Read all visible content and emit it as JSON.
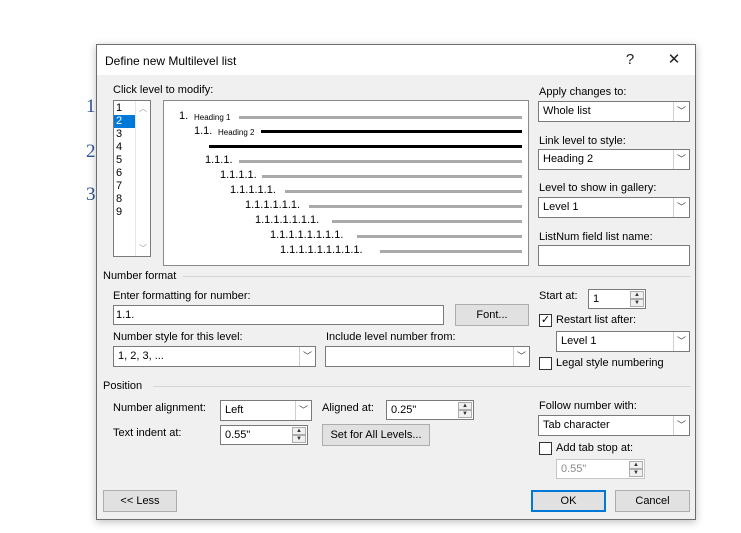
{
  "background_numbers": [
    "1",
    "2",
    "3"
  ],
  "dialog": {
    "title": "Define new Multilevel list",
    "help": "?",
    "close": "✕"
  },
  "levels": {
    "label": "Click level to modify:",
    "items": [
      "1",
      "2",
      "3",
      "4",
      "5",
      "6",
      "7",
      "8",
      "9"
    ],
    "selected": "2"
  },
  "preview": {
    "l1_num": "1.",
    "l1_text": "Heading 1",
    "l2_num": "1.1.",
    "l2_text": "Heading 2",
    "rows": [
      "1.1.1.",
      "1.1.1.1.",
      "1.1.1.1.1.",
      "1.1.1.1.1.1.",
      "1.1.1.1.1.1.1.",
      "1.1.1.1.1.1.1.1.",
      "1.1.1.1.1.1.1.1.1."
    ]
  },
  "apply": {
    "label": "Apply changes to:",
    "value": "Whole list"
  },
  "link": {
    "label": "Link level to style:",
    "value": "Heading 2"
  },
  "gallery": {
    "label": "Level to show in gallery:",
    "value": "Level 1"
  },
  "listnum": {
    "label": "ListNum field list name:",
    "value": ""
  },
  "number_format": {
    "section": "Number format",
    "enter_label": "Enter formatting for number:",
    "value": "1.1.",
    "font_button": "Font...",
    "style_label": "Number style for this level:",
    "style_value": "1, 2, 3, ...",
    "include_label": "Include level number from:",
    "include_value": ""
  },
  "start": {
    "label": "Start at:",
    "value": "1"
  },
  "restart": {
    "label": "Restart list after:",
    "checked": true,
    "value": "Level 1"
  },
  "legal": {
    "label": "Legal style numbering",
    "checked": false
  },
  "position": {
    "section": "Position",
    "align_label": "Number alignment:",
    "align_value": "Left",
    "aligned_at_label": "Aligned at:",
    "aligned_at_value": "0.25\"",
    "indent_label": "Text indent at:",
    "indent_value": "0.55\"",
    "set_all_button": "Set for All Levels..."
  },
  "follow": {
    "label": "Follow number with:",
    "value": "Tab character"
  },
  "tabstop": {
    "label": "Add tab stop at:",
    "checked": false,
    "value": "0.55\""
  },
  "buttons": {
    "less": "<< Less",
    "ok": "OK",
    "cancel": "Cancel"
  }
}
